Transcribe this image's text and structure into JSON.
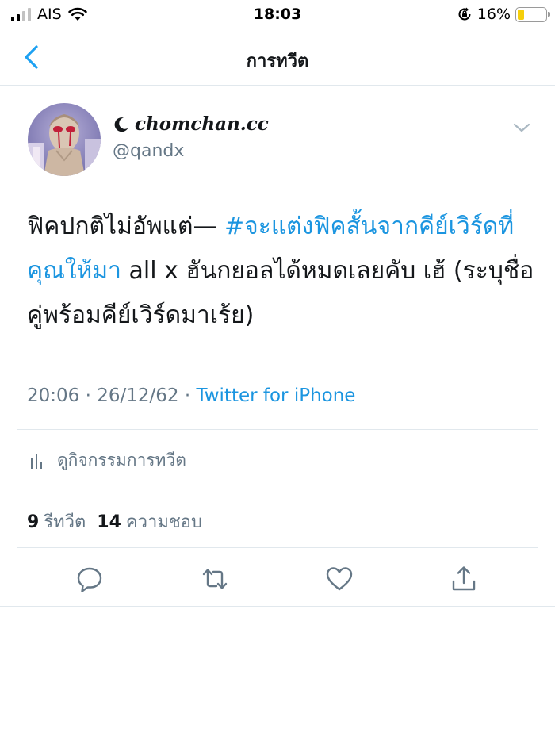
{
  "status_bar": {
    "carrier": "AIS",
    "time": "18:03",
    "battery_percent": "16%",
    "battery_level": 0.16,
    "signal_bars_filled": 2,
    "signal_bars_total": 4
  },
  "nav": {
    "title": "การทวีต",
    "back_icon": "chevron-left-icon"
  },
  "author": {
    "display_name": "chomchan.cc",
    "handle": "@qandx",
    "name_icon": "crescent-moon-icon"
  },
  "tweet": {
    "text_before": "ฟิคปกติไม่อัพแต่— ",
    "hashtag": "#จะแต่งฟิคสั้นจากคีย์เวิร์ดที่คุณให้มา",
    "text_after": " all x ฮันกยอลได้หมดเลยคับ เฮ้ (ระบุชื่อคู่พร้อมคีย์เวิร์ดมาเร้ย)"
  },
  "meta": {
    "time": "20:06",
    "separator": "·",
    "date": "26/12/62",
    "source": "Twitter for iPhone"
  },
  "activity": {
    "label": "ดูกิจกรรมการทวีต",
    "icon": "analytics-bars-icon"
  },
  "stats": {
    "retweets_count": "9",
    "retweets_label": "รีทวีต",
    "likes_count": "14",
    "likes_label": "ความชอบ"
  },
  "actions": [
    "reply-icon",
    "retweet-icon",
    "like-icon",
    "share-icon"
  ],
  "colors": {
    "accent": "#1da1f2",
    "link": "#1b95e0",
    "muted": "#657786",
    "divider": "#e1e8ed",
    "text": "#14171a",
    "battery_low": "#f5cf0a"
  }
}
